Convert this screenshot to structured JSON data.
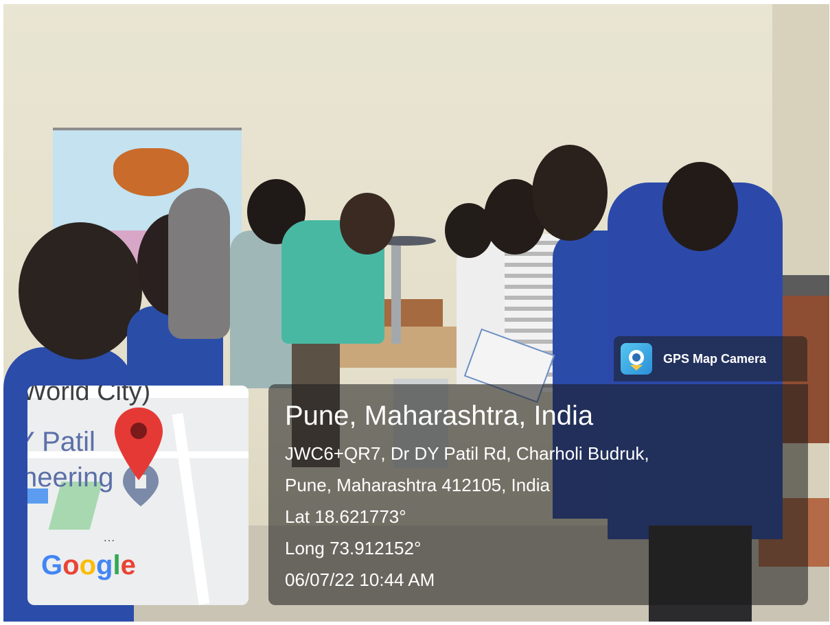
{
  "badge": {
    "label": "GPS Map Camera",
    "icon": "gps-map-camera-icon"
  },
  "location": {
    "city": "Pune, Maharashtra, India",
    "address_line1": "JWC6+QR7, Dr DY Patil Rd, Charholi Budruk,",
    "address_line2": "Pune, Maharashtra 412105, India",
    "lat": "Lat 18.621773°",
    "long": "Long 73.912152°",
    "datetime": "06/07/22 10:44 AM"
  },
  "map": {
    "label_top": "World City)",
    "label_mid": "Y Patil",
    "label_low": "neering",
    "pin_color": "#e53935",
    "google": {
      "letters": [
        "G",
        "o",
        "o",
        "g",
        "l",
        "e"
      ],
      "colors": [
        "#4285F4",
        "#EA4335",
        "#FBBC05",
        "#4285F4",
        "#34A853",
        "#EA4335"
      ]
    }
  },
  "colors": {
    "wall": "#e6e2cf",
    "banner": "#bfe0ee",
    "uniform_blue": "#2a4ea8",
    "overlay": "rgba(25,25,25,0.55)"
  }
}
